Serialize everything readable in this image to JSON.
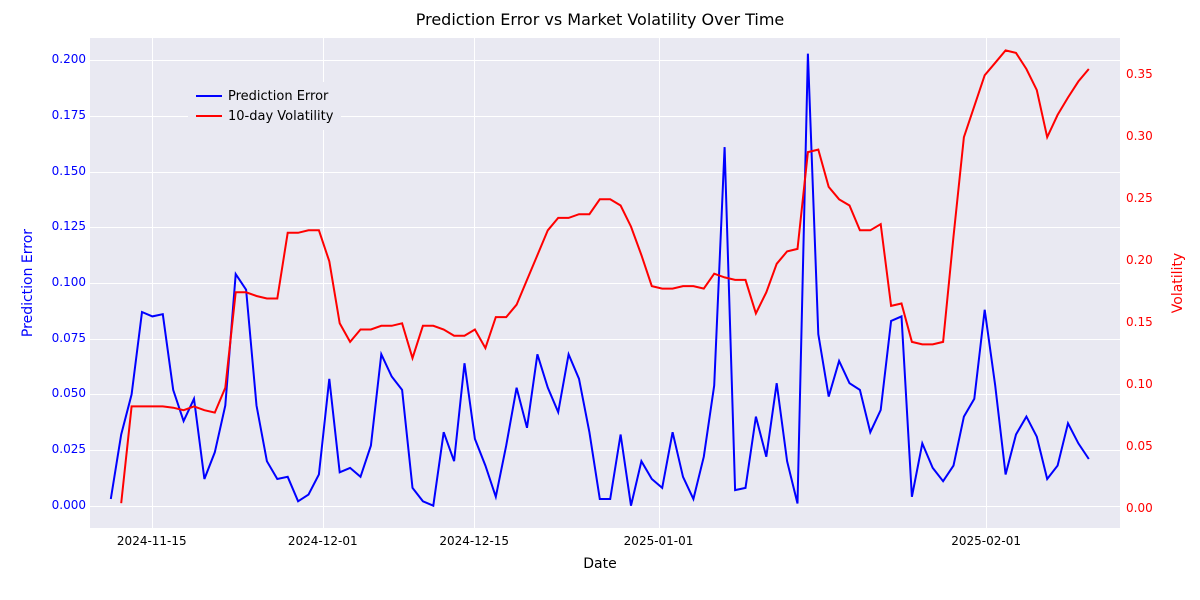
{
  "chart_data": {
    "type": "line",
    "title": "Prediction Error vs Market Volatility Over Time",
    "xlabel": "Date",
    "y1label": "Prediction Error",
    "y2label": "Volatility",
    "y1_range": [
      -0.01,
      0.21
    ],
    "y2_range": [
      -0.015,
      0.38
    ],
    "x_ticks": [
      "2024-11-15",
      "2024-12-01",
      "2024-12-15",
      "2025-01-01",
      "2025-02-01"
    ],
    "x_tick_positions": [
      0.06,
      0.226,
      0.373,
      0.552,
      0.87
    ],
    "y1_ticks": [
      0.0,
      0.025,
      0.05,
      0.075,
      0.1,
      0.125,
      0.15,
      0.175,
      0.2
    ],
    "y2_ticks": [
      0.0,
      0.05,
      0.1,
      0.15,
      0.2,
      0.25,
      0.3,
      0.35
    ],
    "legend": {
      "items": [
        {
          "label": "Prediction Error",
          "color": "#0000ff"
        },
        {
          "label": "10-day Volatility",
          "color": "#ff0000"
        }
      ]
    },
    "x": [
      "2024-11-09",
      "2024-11-10",
      "2024-11-11",
      "2024-11-12",
      "2024-11-13",
      "2024-11-14",
      "2024-11-15",
      "2024-11-16",
      "2024-11-17",
      "2024-11-18",
      "2024-11-19",
      "2024-11-20",
      "2024-11-21",
      "2024-11-22",
      "2024-11-23",
      "2024-11-24",
      "2024-11-25",
      "2024-11-26",
      "2024-11-27",
      "2024-11-28",
      "2024-11-29",
      "2024-11-30",
      "2024-12-01",
      "2024-12-02",
      "2024-12-03",
      "2024-12-04",
      "2024-12-05",
      "2024-12-06",
      "2024-12-07",
      "2024-12-08",
      "2024-12-09",
      "2024-12-10",
      "2024-12-11",
      "2024-12-12",
      "2024-12-13",
      "2024-12-14",
      "2024-12-15",
      "2024-12-16",
      "2024-12-17",
      "2024-12-18",
      "2024-12-19",
      "2024-12-20",
      "2024-12-21",
      "2024-12-22",
      "2024-12-23",
      "2024-12-24",
      "2024-12-25",
      "2024-12-26",
      "2024-12-27",
      "2024-12-28",
      "2024-12-29",
      "2024-12-30",
      "2024-12-31",
      "2025-01-01",
      "2025-01-02",
      "2025-01-03",
      "2025-01-04",
      "2025-01-05",
      "2025-01-06",
      "2025-01-07",
      "2025-01-08",
      "2025-01-09",
      "2025-01-10",
      "2025-01-11",
      "2025-01-12",
      "2025-01-13",
      "2025-01-14",
      "2025-01-15",
      "2025-01-16",
      "2025-01-17",
      "2025-01-18",
      "2025-01-19",
      "2025-01-20",
      "2025-01-21",
      "2025-01-22",
      "2025-01-23",
      "2025-01-24",
      "2025-01-25",
      "2025-01-26",
      "2025-01-27",
      "2025-01-28",
      "2025-01-29",
      "2025-01-30",
      "2025-01-31",
      "2025-02-01",
      "2025-02-02",
      "2025-02-03",
      "2025-02-04",
      "2025-02-05",
      "2025-02-06",
      "2025-02-07",
      "2025-02-02",
      "2025-02-03",
      "2025-02-04",
      "2025-02-05",
      "2025-02-06"
    ],
    "series": [
      {
        "name": "Prediction Error",
        "axis": "y1",
        "color": "#0000ff",
        "values": [
          0.003,
          0.032,
          0.05,
          0.087,
          0.085,
          0.086,
          0.052,
          0.038,
          0.048,
          0.012,
          0.024,
          0.045,
          0.104,
          0.097,
          0.045,
          0.02,
          0.012,
          0.013,
          0.002,
          0.005,
          0.014,
          0.057,
          0.015,
          0.017,
          0.013,
          0.027,
          0.068,
          0.058,
          0.052,
          0.008,
          0.002,
          0.0,
          0.033,
          0.02,
          0.064,
          0.03,
          0.018,
          0.004,
          0.027,
          0.053,
          0.035,
          0.068,
          0.053,
          0.042,
          0.068,
          0.057,
          0.033,
          0.003,
          0.003,
          0.032,
          0.0,
          0.02,
          0.012,
          0.008,
          0.033,
          0.013,
          0.003,
          0.022,
          0.054,
          0.161,
          0.007,
          0.008,
          0.04,
          0.022,
          0.055,
          0.02,
          0.001,
          0.203,
          0.077,
          0.049,
          0.065,
          0.055,
          0.052,
          0.033,
          0.043,
          0.083,
          0.085,
          0.004,
          0.028,
          0.017,
          0.011,
          0.018,
          0.04,
          0.048,
          0.088,
          0.054,
          0.014,
          0.032,
          0.04,
          0.031,
          0.012,
          0.018,
          0.037,
          0.028,
          0.021
        ]
      },
      {
        "name": "10-day Volatility",
        "axis": "y2",
        "color": "#ff0000",
        "values": [
          null,
          0.005,
          0.083,
          0.083,
          0.083,
          0.083,
          0.082,
          0.08,
          0.083,
          0.08,
          0.078,
          0.098,
          0.175,
          0.175,
          0.172,
          0.17,
          0.17,
          0.223,
          0.223,
          0.225,
          0.225,
          0.2,
          0.15,
          0.135,
          0.145,
          0.145,
          0.148,
          0.148,
          0.15,
          0.122,
          0.148,
          0.148,
          0.145,
          0.14,
          0.14,
          0.145,
          0.13,
          0.155,
          0.155,
          0.165,
          0.185,
          0.205,
          0.225,
          0.235,
          0.235,
          0.238,
          0.238,
          0.25,
          0.25,
          0.245,
          0.228,
          0.205,
          0.18,
          0.178,
          0.178,
          0.18,
          0.18,
          0.178,
          0.19,
          0.187,
          0.185,
          0.185,
          0.158,
          0.175,
          0.198,
          0.208,
          0.21,
          0.288,
          0.29,
          0.26,
          0.25,
          0.245,
          0.225,
          0.225,
          0.23,
          0.164,
          0.166,
          0.135,
          0.133,
          0.133,
          0.135,
          0.22,
          0.3,
          0.325,
          0.35,
          0.36,
          0.37,
          0.368,
          0.355,
          0.338,
          0.3,
          0.318,
          0.332,
          0.345,
          0.355
        ]
      }
    ]
  }
}
